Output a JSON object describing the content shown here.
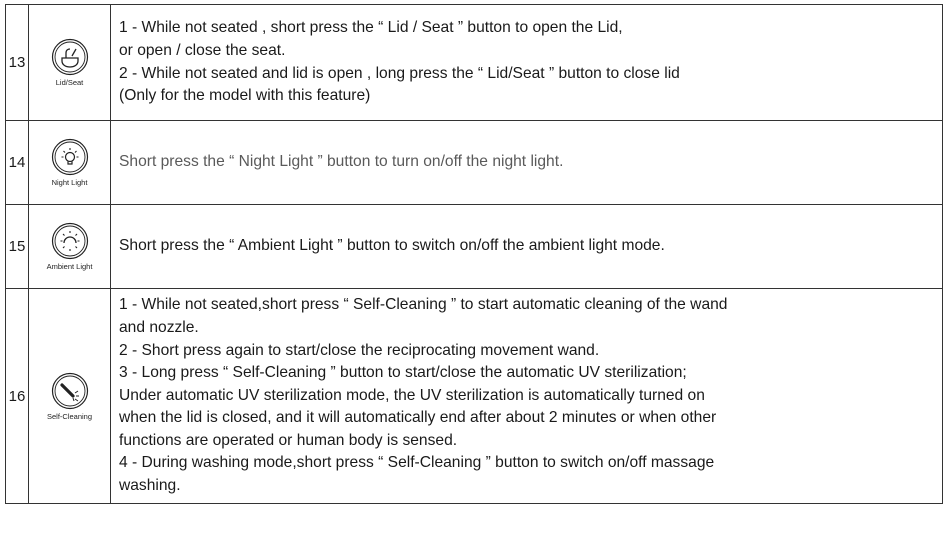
{
  "rows": [
    {
      "number": "13",
      "icon": "lid-seat-icon",
      "icon_label": "Lid/Seat",
      "lines": [
        "1 - While not seated , short press the “ Lid / Seat ” button to open the Lid,",
        "or open / close the seat.",
        "2 - While not seated and lid is open , long press the “ Lid/Seat ” button to close lid",
        "(Only for the model with this feature)"
      ]
    },
    {
      "number": "14",
      "icon": "night-light-icon",
      "icon_label": "Night  Light",
      "lines": [
        "Short press the  “ Night Light ”  button to turn on/off the night light."
      ]
    },
    {
      "number": "15",
      "icon": "ambient-light-icon",
      "icon_label": "Ambient  Light",
      "lines": [
        "Short press the  “ Ambient Light ” button to switch on/off the ambient light mode."
      ]
    },
    {
      "number": "16",
      "icon": "self-cleaning-icon",
      "icon_label": "Self-Cleaning",
      "lines": [
        "1 - While not seated,short press “ Self-Cleaning ” to start automatic cleaning of the wand",
        "and nozzle.",
        "2 - Short press again to start/close the reciprocating movement wand.",
        "3 - Long press “ Self-Cleaning ” button to start/close the automatic UV sterilization;",
        "Under automatic UV sterilization mode, the UV sterilization is automatically turned on",
        "when the lid is closed, and it will automatically end after about 2 minutes or when other",
        "functions are operated or human body is sensed.",
        "4 - During washing mode,short press “ Self-Cleaning ” button to switch on/off massage",
        "washing."
      ]
    }
  ]
}
